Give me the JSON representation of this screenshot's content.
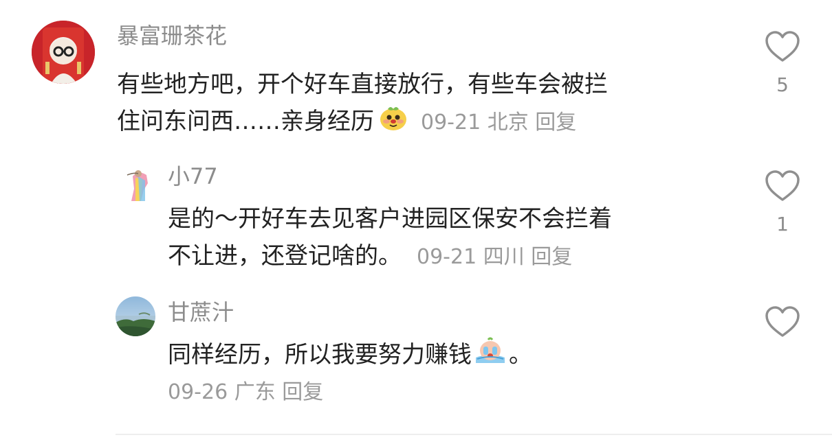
{
  "comments": [
    {
      "username": "暴富珊茶花",
      "text_line1": "有些地方吧，开个好车直接放行，有些车会被拦",
      "text_line2": "住问东问西……亲身经历",
      "date": "09-21",
      "location": "北京",
      "reply_label": "回复",
      "like_count": "5",
      "emoji_icon": "dog-face-emoji"
    },
    {
      "username": "小77",
      "text_line1": "是的～开好车去见客户进园区保安不会拦着",
      "text_line2": "不让进，还登记啥的。",
      "date": "09-21",
      "location": "四川",
      "reply_label": "回复",
      "like_count": "1"
    },
    {
      "username": "甘蔗汁",
      "text_line1": "同样经历，所以我要努力赚钱",
      "text_line1_suffix": "。",
      "date": "09-26",
      "location": "广东",
      "reply_label": "回复",
      "like_count": "",
      "emoji_icon": "crying-face-emoji"
    }
  ]
}
